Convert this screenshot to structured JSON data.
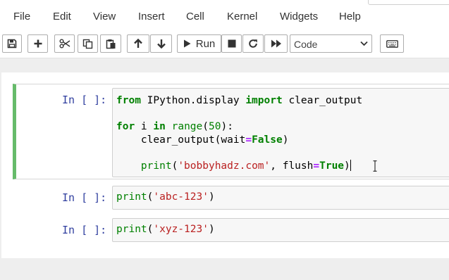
{
  "menu": {
    "items": [
      "File",
      "Edit",
      "View",
      "Insert",
      "Cell",
      "Kernel",
      "Widgets",
      "Help"
    ]
  },
  "toolbar": {
    "run_label": "Run",
    "cell_type": "Code",
    "icons": [
      "save-icon",
      "plus-icon",
      "scissors-icon",
      "copy-icon",
      "paste-icon",
      "arrow-up-icon",
      "arrow-down-icon",
      "play-icon",
      "stop-icon",
      "restart-icon",
      "fast-forward-icon",
      "keyboard-icon"
    ]
  },
  "cells": [
    {
      "prompt": "In [ ]:",
      "lines": [
        [
          {
            "t": "from",
            "c": "kw"
          },
          {
            "t": " IPython.display "
          },
          {
            "t": "import",
            "c": "kw"
          },
          {
            "t": " clear_output"
          }
        ],
        [],
        [
          {
            "t": "for",
            "c": "kw"
          },
          {
            "t": " i "
          },
          {
            "t": "in",
            "c": "kw"
          },
          {
            "t": " "
          },
          {
            "t": "range",
            "c": "bi"
          },
          {
            "t": "("
          },
          {
            "t": "50",
            "c": "num"
          },
          {
            "t": "):"
          }
        ],
        [
          {
            "t": "    clear_output(wait"
          },
          {
            "t": "=",
            "c": "op"
          },
          {
            "t": "False",
            "c": "kw"
          },
          {
            "t": ")"
          }
        ],
        [],
        [
          {
            "t": "    "
          },
          {
            "t": "print",
            "c": "bi"
          },
          {
            "t": "("
          },
          {
            "t": "'bobbyhadz.com'",
            "c": "str"
          },
          {
            "t": ", flush"
          },
          {
            "t": "=",
            "c": "op"
          },
          {
            "t": "True",
            "c": "kw"
          },
          {
            "t": ")"
          }
        ]
      ]
    },
    {
      "prompt": "In [ ]:",
      "lines": [
        [
          {
            "t": "print",
            "c": "bi"
          },
          {
            "t": "("
          },
          {
            "t": "'abc-123'",
            "c": "str"
          },
          {
            "t": ")"
          }
        ]
      ]
    },
    {
      "prompt": "In [ ]:",
      "lines": [
        [
          {
            "t": "print",
            "c": "bi"
          },
          {
            "t": "("
          },
          {
            "t": "'xyz-123'",
            "c": "str"
          },
          {
            "t": ")"
          }
        ]
      ]
    }
  ]
}
